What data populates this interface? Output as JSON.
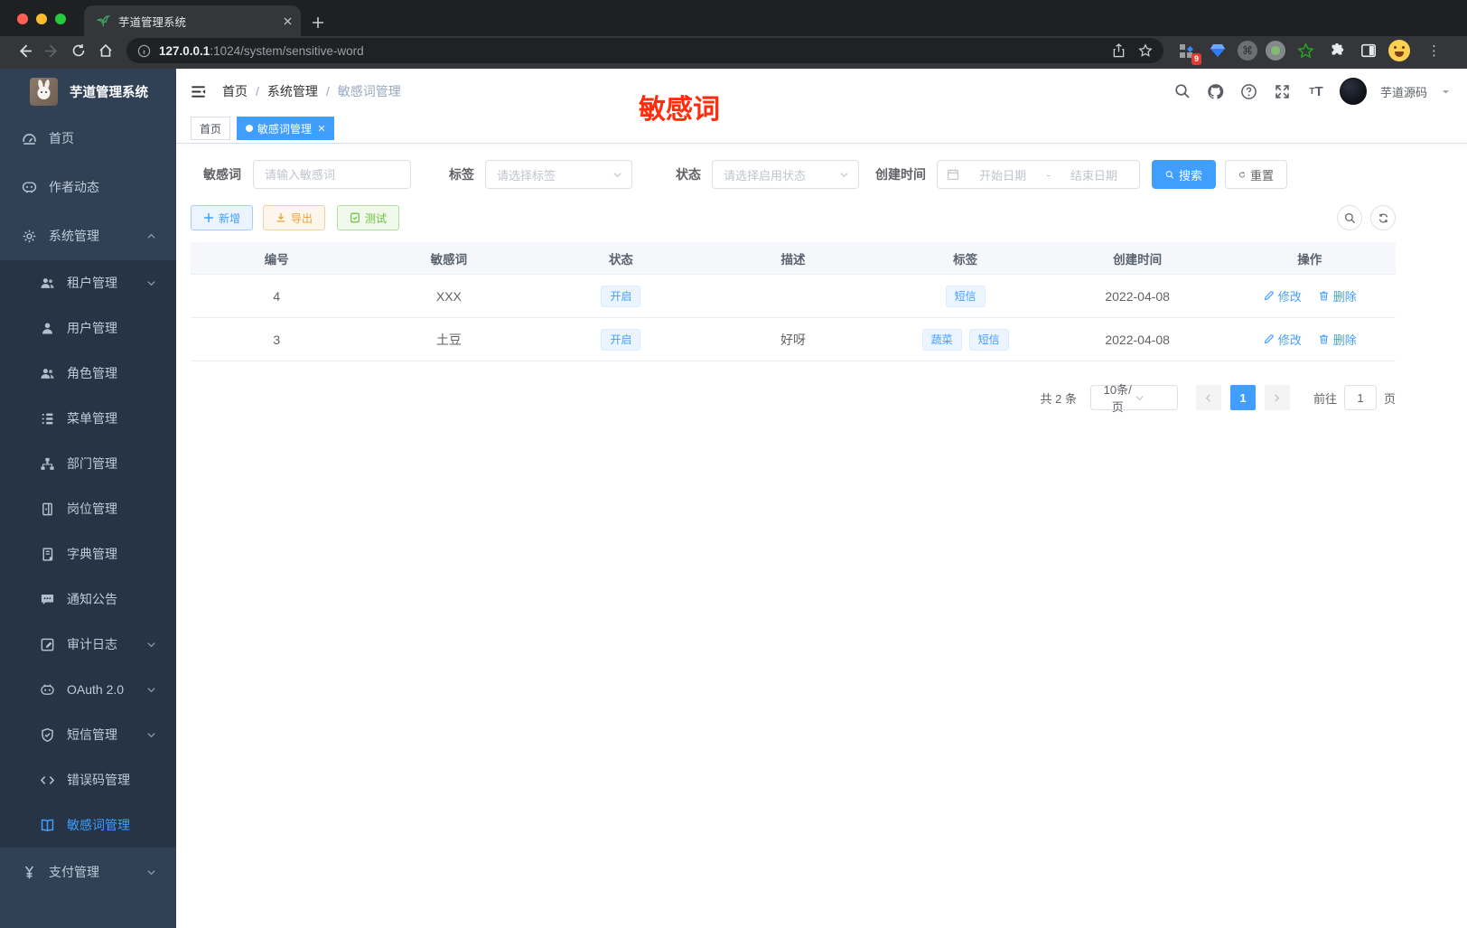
{
  "browser": {
    "tab_title": "芋道管理系统",
    "url_host": "127.0.0.1",
    "url_path": ":1024/system/sensitive-word",
    "extension_badge": "9"
  },
  "sidebar": {
    "logo_title": "芋道管理系统",
    "items": [
      {
        "label": "首页",
        "icon": "dashboard-icon"
      },
      {
        "label": "作者动态",
        "icon": "author-chat-icon"
      },
      {
        "label": "系统管理",
        "icon": "gear-icon",
        "state": "expanded"
      }
    ],
    "sub_items": [
      {
        "label": "租户管理",
        "icon": "tenant-users-icon",
        "caret": "down"
      },
      {
        "label": "用户管理",
        "icon": "user-icon"
      },
      {
        "label": "角色管理",
        "icon": "roles-icon"
      },
      {
        "label": "菜单管理",
        "icon": "menu-tree-icon"
      },
      {
        "label": "部门管理",
        "icon": "org-icon"
      },
      {
        "label": "岗位管理",
        "icon": "post-icon"
      },
      {
        "label": "字典管理",
        "icon": "dict-book-icon"
      },
      {
        "label": "通知公告",
        "icon": "notice-comment-icon"
      },
      {
        "label": "审计日志",
        "icon": "audit-log-icon",
        "caret": "down"
      },
      {
        "label": "OAuth 2.0",
        "icon": "oauth-icon",
        "caret": "down"
      },
      {
        "label": "短信管理",
        "icon": "sms-shield-icon",
        "caret": "down"
      },
      {
        "label": "错误码管理",
        "icon": "error-code-icon"
      },
      {
        "label": "敏感词管理",
        "icon": "sensitive-word-book-icon",
        "active": true
      }
    ],
    "bottom_items": [
      {
        "label": "支付管理",
        "icon": "pay-yen-icon",
        "caret": "down"
      }
    ]
  },
  "header": {
    "breadcrumb": {
      "items": [
        "首页",
        "系统管理",
        "敏感词管理"
      ],
      "separator": "/"
    },
    "annotation": "敏感词",
    "username": "芋道源码"
  },
  "tags_view": {
    "tabs": [
      {
        "label": "首页",
        "active": false
      },
      {
        "label": "敏感词管理",
        "active": true
      }
    ]
  },
  "filters": {
    "keyword_label": "敏感词",
    "keyword_placeholder": "请输入敏感词",
    "tag_label": "标签",
    "tag_placeholder": "请选择标签",
    "status_label": "状态",
    "status_placeholder": "请选择启用状态",
    "created_label": "创建时间",
    "date_start_placeholder": "开始日期",
    "date_separator": "-",
    "date_end_placeholder": "结束日期",
    "search_label": "搜索",
    "reset_label": "重置"
  },
  "toolbar": {
    "add_label": "新增",
    "export_label": "导出",
    "test_label": "测试"
  },
  "table": {
    "headers": [
      "编号",
      "敏感词",
      "状态",
      "描述",
      "标签",
      "创建时间",
      "操作"
    ],
    "rows": [
      {
        "id": "4",
        "word": "XXX",
        "status": "开启",
        "description": "",
        "tags": [
          "短信"
        ],
        "created": "2022-04-08"
      },
      {
        "id": "3",
        "word": "土豆",
        "status": "开启",
        "description": "好呀",
        "tags": [
          "蔬菜",
          "短信"
        ],
        "created": "2022-04-08"
      }
    ],
    "edit_label": "修改",
    "delete_label": "删除"
  },
  "pagination": {
    "total": "共 2 条",
    "page_size": "10条/页",
    "page": "1",
    "goto_label": "前往",
    "goto_value": "1",
    "unit_label": "页"
  },
  "colors": {
    "accent": "#409eff",
    "warning": "#e6a23c",
    "success": "#67c23a",
    "annotation_red": "#ff2d0d",
    "sidebar_bg": "#304156",
    "submenu_bg": "#263445"
  }
}
